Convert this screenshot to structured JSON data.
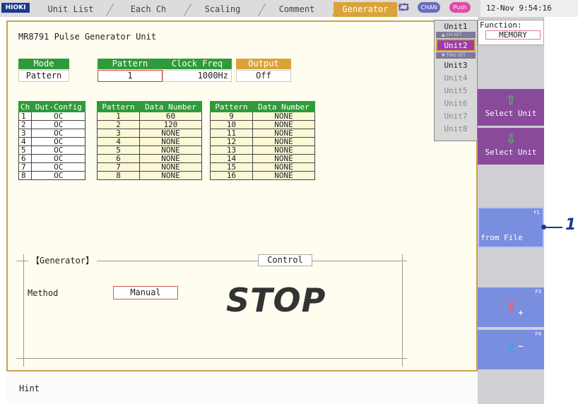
{
  "header": {
    "logo": "HIOKI",
    "tabs": [
      {
        "label": "Unit List",
        "active": false
      },
      {
        "label": "Each Ch",
        "active": false
      },
      {
        "label": "Scaling",
        "active": false
      },
      {
        "label": "Comment",
        "active": false
      },
      {
        "label": "Generator",
        "active": true
      }
    ],
    "chan_label": "CHAN",
    "push_label": "Push",
    "datetime": "12-Nov  9:54:16"
  },
  "sidebar": {
    "function_label": "Function:",
    "function_value": "MEMORY",
    "units": [
      "Unit1",
      "Unit2",
      "Unit3",
      "Unit4",
      "Unit5",
      "Unit6",
      "Unit7",
      "Unit8"
    ],
    "selected_unit": "Unit2",
    "ch_set_label": "CH SET",
    "trig_set_label": "TRIG SET",
    "select_unit_up": "Select Unit",
    "select_unit_down": "Select Unit",
    "f1_label": "F1",
    "from_file_label": "from File",
    "f3_label": "F3",
    "f4_label": "F4"
  },
  "main": {
    "title": "MR8791 Pulse Generator Unit",
    "mode": {
      "header": "Mode",
      "value": "Pattern"
    },
    "pattern": {
      "header": "Pattern",
      "value": "1"
    },
    "clock_freq": {
      "header": "Clock Freq",
      "value": "1000Hz"
    },
    "output": {
      "header": "Output",
      "value": "Off"
    },
    "ch_table": {
      "headers": [
        "Ch",
        "Out-Config"
      ],
      "rows": [
        [
          "1",
          "OC"
        ],
        [
          "2",
          "OC"
        ],
        [
          "3",
          "OC"
        ],
        [
          "4",
          "OC"
        ],
        [
          "5",
          "OC"
        ],
        [
          "6",
          "OC"
        ],
        [
          "7",
          "OC"
        ],
        [
          "8",
          "OC"
        ]
      ]
    },
    "pattern_table_1": {
      "headers": [
        "Pattern",
        "Data Number"
      ],
      "rows": [
        [
          "1",
          "60"
        ],
        [
          "2",
          "120"
        ],
        [
          "3",
          "NONE"
        ],
        [
          "4",
          "NONE"
        ],
        [
          "5",
          "NONE"
        ],
        [
          "6",
          "NONE"
        ],
        [
          "7",
          "NONE"
        ],
        [
          "8",
          "NONE"
        ]
      ]
    },
    "pattern_table_2": {
      "headers": [
        "Pattern",
        "Data Number"
      ],
      "rows": [
        [
          "9",
          "NONE"
        ],
        [
          "10",
          "NONE"
        ],
        [
          "11",
          "NONE"
        ],
        [
          "12",
          "NONE"
        ],
        [
          "13",
          "NONE"
        ],
        [
          "14",
          "NONE"
        ],
        [
          "15",
          "NONE"
        ],
        [
          "16",
          "NONE"
        ]
      ]
    },
    "generator": {
      "label": "【Generator】",
      "control_label": "Control",
      "method_label": "Method",
      "method_value": "Manual",
      "status": "STOP"
    },
    "hint": "Hint"
  },
  "callout": {
    "number": "1"
  },
  "colors": {
    "accent": "#d9a33a",
    "header_green": "#2f9a3a",
    "side_purple": "#8a4a9c",
    "side_blue": "#7a8ee0"
  }
}
